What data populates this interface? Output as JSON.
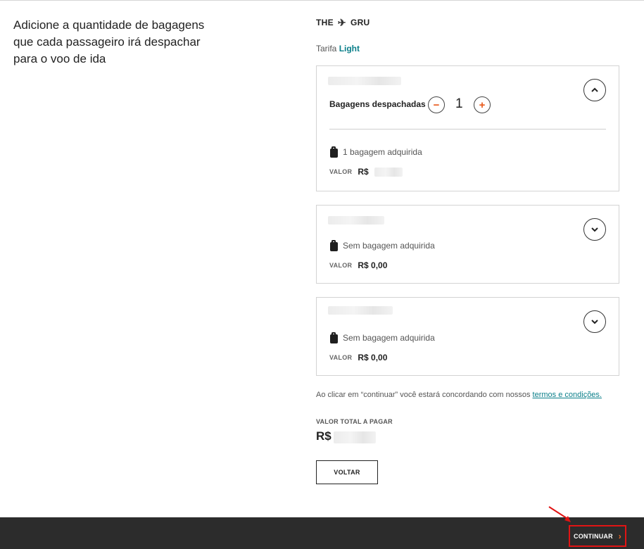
{
  "heading": "Adicione a quantidade de bagagens que cada passageiro irá despachar para o voo de ida",
  "route": {
    "origin": "THE",
    "destination": "GRU",
    "icon": "plane-icon"
  },
  "fare": {
    "prefix": "Tarifa",
    "name": "Light"
  },
  "passengers": [
    {
      "expanded": true,
      "toggle_icon": "chevron-up-icon",
      "counter_label": "Bagagens despachadas",
      "decrement_symbol": "−",
      "increment_symbol": "+",
      "count": "1",
      "bag_status": "1 bagagem adquirida",
      "price_label": "VALOR",
      "price_value": "R$"
    },
    {
      "expanded": false,
      "toggle_icon": "chevron-down-icon",
      "bag_status": "Sem bagagem adquirida",
      "price_label": "VALOR",
      "price_value": "R$ 0,00"
    },
    {
      "expanded": false,
      "toggle_icon": "chevron-down-icon",
      "bag_status": "Sem bagagem adquirida",
      "price_label": "VALOR",
      "price_value": "R$ 0,00"
    }
  ],
  "terms": {
    "text": "Ao clicar em “continuar” você estará concordando com nossos",
    "link": "termos e condições."
  },
  "total": {
    "label": "VALOR TOTAL A PAGAR",
    "value": "R$"
  },
  "buttons": {
    "back": "VOLTAR",
    "continue": "CONTINUAR"
  },
  "colors": {
    "accent_orange": "#f26522",
    "link_teal": "#0b7f8a",
    "footer_bg": "#2c2c2c",
    "highlight_red": "#e11414"
  }
}
